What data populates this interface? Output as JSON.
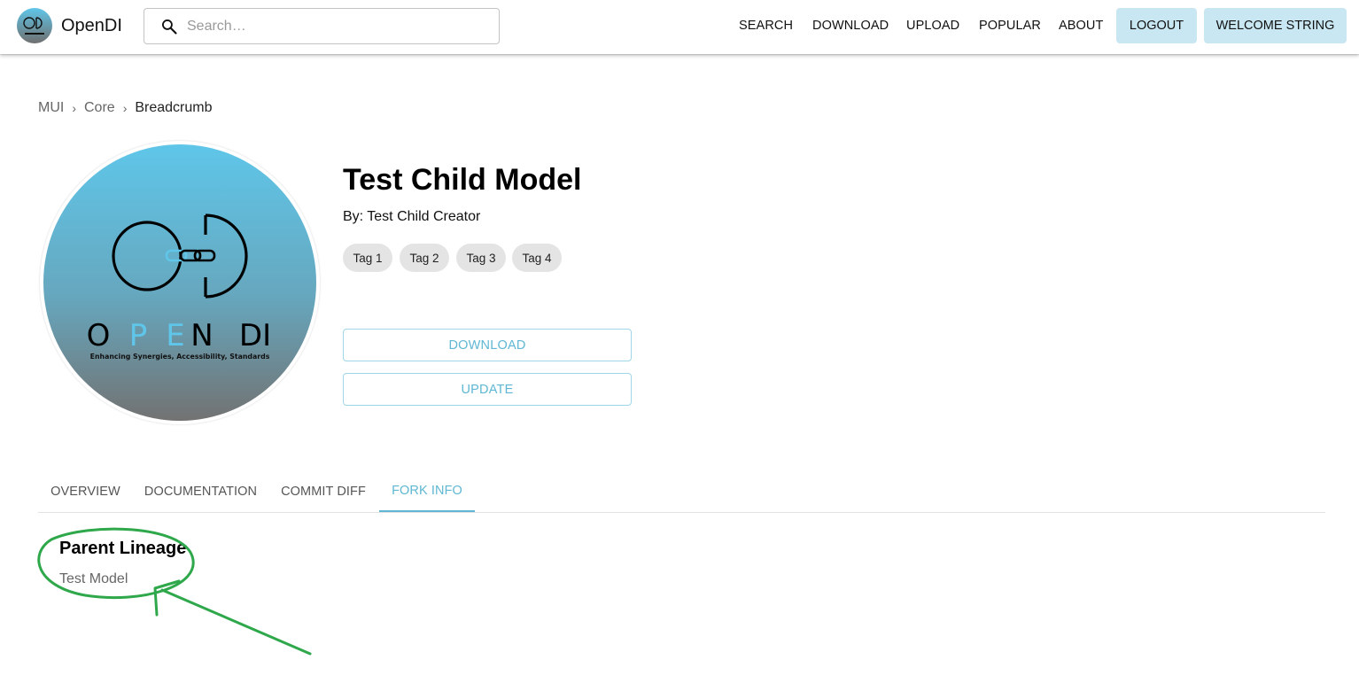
{
  "app": {
    "name": "OpenDI",
    "logo_icon": "opendi-logo-icon"
  },
  "search": {
    "placeholder": "Search…",
    "value": "",
    "icon": "search-icon"
  },
  "nav": {
    "links": [
      "SEARCH",
      "DOWNLOAD",
      "UPLOAD",
      "POPULAR",
      "ABOUT"
    ],
    "logout_label": "LOGOUT",
    "welcome_label": "WELCOME STRING"
  },
  "breadcrumb": {
    "items": [
      "MUI",
      "Core",
      "Breadcrumb"
    ],
    "separator": "›"
  },
  "model": {
    "title": "Test Child Model",
    "author": "By: Test Child Creator",
    "tags": [
      "Tag 1",
      "Tag 2",
      "Tag 3",
      "Tag 4"
    ],
    "download_label": "DOWNLOAD",
    "update_label": "UPDATE",
    "image": {
      "wordmark": "O P E N  DI",
      "tagline": "Enhancing Synergies, Accessibility, Standards"
    }
  },
  "tabs": {
    "items": [
      "OVERVIEW",
      "DOCUMENTATION",
      "COMMIT DIFF",
      "FORK INFO"
    ],
    "active": "FORK INFO"
  },
  "fork_info": {
    "heading": "Parent Lineage",
    "parents": [
      "Test Model"
    ]
  },
  "colors": {
    "accent": "#5fb7d3",
    "nav_button_bg": "#c9e7f2",
    "annotation": "#2ea84a",
    "logo_gradient_top": "#5fc6e9",
    "logo_gradient_bottom": "#707070"
  }
}
